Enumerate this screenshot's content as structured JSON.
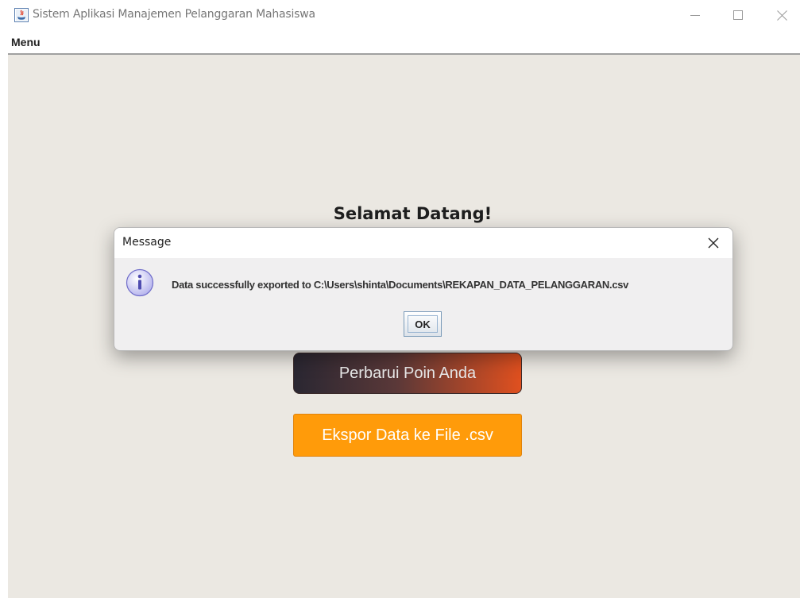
{
  "window": {
    "title": "Sistem Aplikasi Manajemen Pelanggaran Mahasiswa",
    "icon": "java-app-icon",
    "controls": [
      "minimize-icon",
      "maximize-icon",
      "close-icon"
    ]
  },
  "menubar": {
    "items": [
      {
        "label": "Menu"
      }
    ]
  },
  "main": {
    "welcome_text": "Selamat Datang!",
    "buttons": {
      "update_points": "Perbarui Poin Anda",
      "export_csv": "Ekspor Data ke File .csv"
    },
    "colors": {
      "background": "#ebe8e2",
      "export_button": "#ff9b0a",
      "update_button_gradient_start": "#2a2732",
      "update_button_gradient_end": "#e0501f"
    }
  },
  "dialog": {
    "title": "Message",
    "icon": "info-icon",
    "message": "Data successfully exported to C:\\Users\\shinta\\Documents\\REKAPAN_DATA_PELANGGARAN.csv",
    "ok_label": "OK"
  }
}
